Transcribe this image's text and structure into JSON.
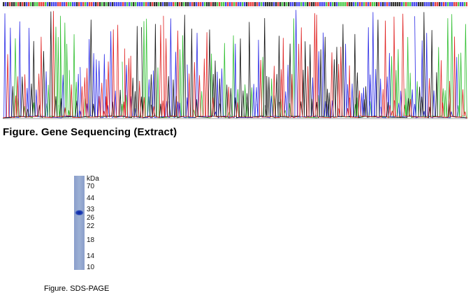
{
  "sequencing": {
    "caption": "Figure. Gene Sequencing (Extract)",
    "trace_colors": {
      "A": "#2fbf2f",
      "C": "#2a2ae6",
      "G": "#111111",
      "T": "#e02020"
    }
  },
  "sds_page": {
    "caption": "Figure. SDS-PAGE",
    "unit_label": "kDa",
    "markers": [
      "70",
      "44",
      "33",
      "26",
      "22",
      "18",
      "14",
      "10"
    ],
    "band_colors": {
      "lane": "#97a9cc",
      "band": "#0d2a9c"
    }
  }
}
